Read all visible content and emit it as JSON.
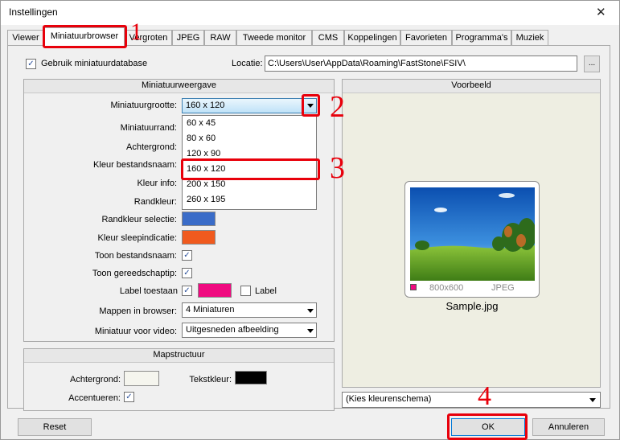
{
  "window": {
    "title": "Instellingen"
  },
  "tabs": [
    {
      "label": "Viewer"
    },
    {
      "label": "Miniatuurbrowser"
    },
    {
      "label": "Vergroten"
    },
    {
      "label": "JPEG"
    },
    {
      "label": "RAW"
    },
    {
      "label": "Tweede monitor"
    },
    {
      "label": "CMS"
    },
    {
      "label": "Koppelingen"
    },
    {
      "label": "Favorieten"
    },
    {
      "label": "Programma's"
    },
    {
      "label": "Muziek"
    }
  ],
  "top": {
    "use_db_label": "Gebruik miniatuurdatabase",
    "use_db_checked": true,
    "location_label": "Locatie:",
    "location_value": "C:\\Users\\User\\AppData\\Roaming\\FastStone\\FSIV\\",
    "browse_label": "..."
  },
  "thumbview": {
    "header": "Miniatuurweergave",
    "size_label": "Miniatuurgrootte:",
    "size_value": "160 x 120",
    "size_options": [
      "60 x 45",
      "80 x 60",
      "120 x 90",
      "160 x 120",
      "200 x 150",
      "260 x 195"
    ],
    "border_label": "Miniatuurrand:",
    "background_label": "Achtergrond:",
    "filename_color_label": "Kleur bestandsnaam:",
    "info_color_label": "Kleur info:",
    "border_color_label": "Randkleur:",
    "sel_border_color_label": "Randkleur selectie:",
    "sel_border_color": "#3a6cc8",
    "drag_color_label": "Kleur sleepindicatie:",
    "drag_color": "#f05a1e",
    "show_filename_label": "Toon bestandsnaam:",
    "show_tooltip_label": "Toon gereedschaptip:",
    "show_label_label": "Label toestaan",
    "label_color": "#f00a80",
    "label_checkbox_label": "Label",
    "folders_label": "Mappen in browser:",
    "folders_value": "4 Miniaturen",
    "video_label": "Miniatuur voor video:",
    "video_value": "Uitgesneden afbeelding"
  },
  "folder": {
    "header": "Mapstructuur",
    "background_label": "Achtergrond:",
    "background_color": "#f5f5ee",
    "text_color_label": "Tekstkleur:",
    "text_color": "#000000",
    "highlight_label": "Accentueren:"
  },
  "preview": {
    "header": "Voorbeeld",
    "resolution": "800x600",
    "format": "JPEG",
    "filename": "Sample.jpg",
    "scheme_value": "(Kies kleurenschema)"
  },
  "footer": {
    "reset_label": "Reset",
    "ok_label": "OK",
    "cancel_label": "Annuleren"
  },
  "annotations": {
    "n1": "1",
    "n2": "2",
    "n3": "3",
    "n4": "4"
  }
}
